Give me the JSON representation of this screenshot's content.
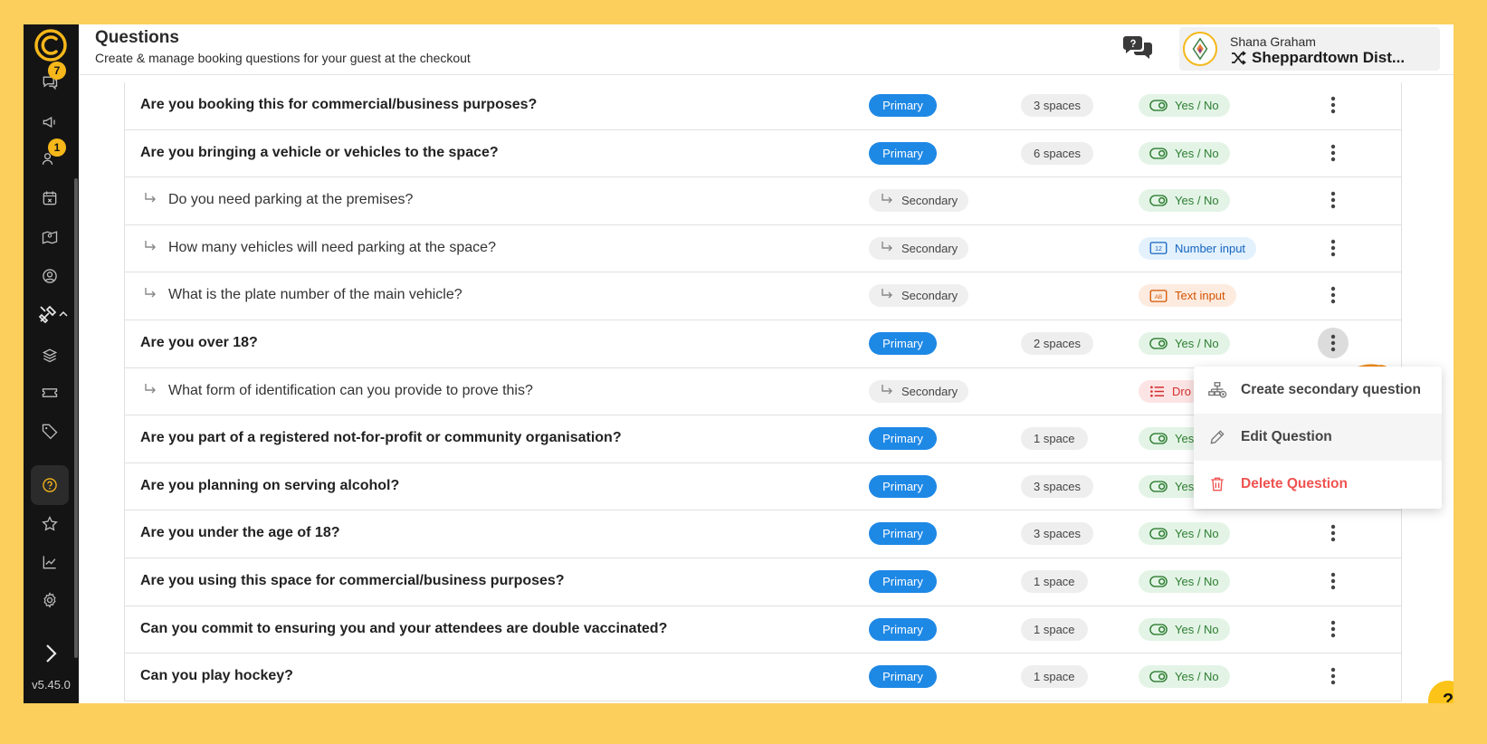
{
  "app": {
    "version": "v5.45.0"
  },
  "sidebar": {
    "badges": {
      "messages": "7",
      "users": "1"
    },
    "items": [
      {
        "name": "messages-icon"
      },
      {
        "name": "megaphone-icon"
      },
      {
        "name": "users-icon"
      },
      {
        "name": "calendar-icon"
      },
      {
        "name": "spaces-map-icon"
      },
      {
        "name": "profile-icon"
      },
      {
        "name": "tools-icon"
      },
      {
        "name": "layers-icon"
      },
      {
        "name": "ticket-icon"
      },
      {
        "name": "tag-icon"
      },
      {
        "name": "questions-icon"
      },
      {
        "name": "star-icon"
      },
      {
        "name": "chart-icon"
      },
      {
        "name": "settings-icon"
      }
    ]
  },
  "header": {
    "title": "Questions",
    "subtitle": "Create & manage booking questions for your guest at the checkout",
    "user_name": "Shana Graham",
    "venue": "Sheppardtown Dist..."
  },
  "questions": [
    {
      "text": "Are you booking this for commercial/business purposes?",
      "type": "Primary",
      "spaces": "3 spaces",
      "answer": "Yes / No",
      "answer_kind": "yesno"
    },
    {
      "text": "Are you bringing a vehicle or vehicles to the space?",
      "type": "Primary",
      "spaces": "6 spaces",
      "answer": "Yes / No",
      "answer_kind": "yesno"
    },
    {
      "text": "Do you need parking at the premises?",
      "type": "Secondary",
      "spaces": "",
      "answer": "Yes / No",
      "answer_kind": "yesno"
    },
    {
      "text": "How many vehicles will need parking at the space?",
      "type": "Secondary",
      "spaces": "",
      "answer": "Number input",
      "answer_kind": "number"
    },
    {
      "text": "What is the plate number of the main vehicle?",
      "type": "Secondary",
      "spaces": "",
      "answer": "Text input",
      "answer_kind": "text"
    },
    {
      "text": "Are you over 18?",
      "type": "Primary",
      "spaces": "2 spaces",
      "answer": "Yes / No",
      "answer_kind": "yesno"
    },
    {
      "text": "What form of identification can you provide to prove this?",
      "type": "Secondary",
      "spaces": "",
      "answer": "Dro",
      "answer_kind": "drop"
    },
    {
      "text": "Are you part of a registered not-for-profit or community organisation?",
      "type": "Primary",
      "spaces": "1 space",
      "answer": "Yes",
      "answer_kind": "yesno"
    },
    {
      "text": "Are you planning on serving alcohol?",
      "type": "Primary",
      "spaces": "3 spaces",
      "answer": "Yes",
      "answer_kind": "yesno"
    },
    {
      "text": "Are you under the age of 18?",
      "type": "Primary",
      "spaces": "3 spaces",
      "answer": "Yes / No",
      "answer_kind": "yesno"
    },
    {
      "text": "Are you using this space for commercial/business purposes?",
      "type": "Primary",
      "spaces": "1 space",
      "answer": "Yes / No",
      "answer_kind": "yesno"
    },
    {
      "text": "Can you commit to ensuring you and your attendees are double vaccinated?",
      "type": "Primary",
      "spaces": "1 space",
      "answer": "Yes / No",
      "answer_kind": "yesno"
    },
    {
      "text": "Can you play hockey?",
      "type": "Primary",
      "spaces": "1 space",
      "answer": "Yes / No",
      "answer_kind": "yesno"
    }
  ],
  "context_menu": {
    "create_secondary": "Create secondary question",
    "edit": "Edit Question",
    "delete": "Delete Question"
  },
  "help": {
    "label": "?"
  },
  "colors": {
    "background": "#fccf5c",
    "sidebar": "#141414",
    "primary_pill": "#1e88e5",
    "accent": "#f5b71a",
    "annotation": "#f08a1d",
    "danger": "#ef5350"
  }
}
